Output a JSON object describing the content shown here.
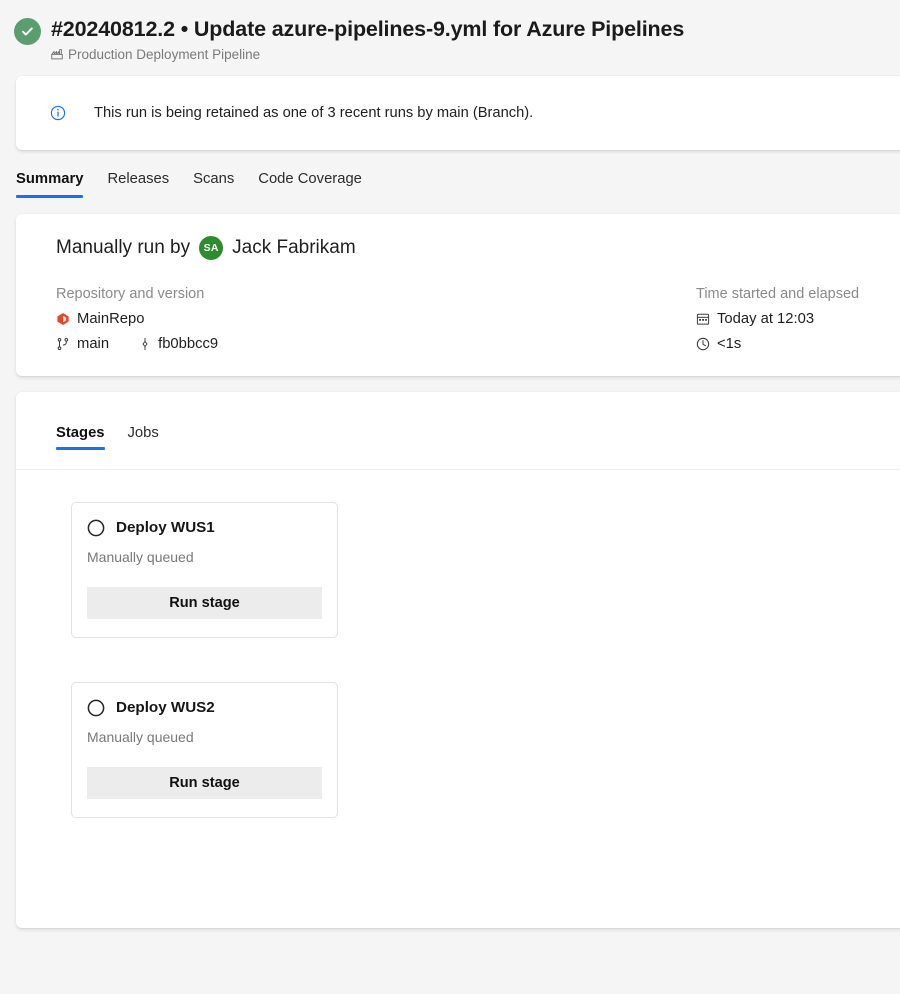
{
  "header": {
    "status_icon": "check-circle-icon",
    "status_color": "#5a9e6f",
    "run_title": "#20240812.2 • Update azure-pipelines-9.yml for Azure Pipelines",
    "pipeline_icon": "pipeline-icon",
    "pipeline_name": "Production Deployment Pipeline"
  },
  "info_banner": {
    "icon": "info-circle-icon",
    "icon_color": "#1f6feb",
    "message": "This run is being retained as one of 3 recent runs by main (Branch)."
  },
  "tabs": [
    {
      "label": "Summary",
      "active": true
    },
    {
      "label": "Releases",
      "active": false
    },
    {
      "label": "Scans",
      "active": false
    },
    {
      "label": "Code Coverage",
      "active": false
    }
  ],
  "summary": {
    "run_by_prefix": "Manually run by",
    "avatar_initials": "SA",
    "avatar_color": "#2e8b2e",
    "run_by_name": "Jack Fabrikam",
    "repository": {
      "label": "Repository and version",
      "repo_icon": "azure-repos-icon",
      "repo_name": "MainRepo",
      "branch_icon": "branch-icon",
      "branch_name": "main",
      "commit_icon": "commit-icon",
      "commit_sha": "fb0bbcc9"
    },
    "time": {
      "label": "Time started and elapsed",
      "calendar_icon": "calendar-icon",
      "started": "Today at 12:03",
      "clock_icon": "clock-icon",
      "elapsed": "<1s"
    }
  },
  "stages_section": {
    "tabs": [
      {
        "label": "Stages",
        "active": true
      },
      {
        "label": "Jobs",
        "active": false
      }
    ],
    "stages": [
      {
        "status_icon": "pending-circle-icon",
        "name": "Deploy WUS1",
        "status_text": "Manually queued",
        "action_label": "Run stage"
      },
      {
        "status_icon": "pending-circle-icon",
        "name": "Deploy WUS2",
        "status_text": "Manually queued",
        "action_label": "Run stage"
      }
    ]
  }
}
